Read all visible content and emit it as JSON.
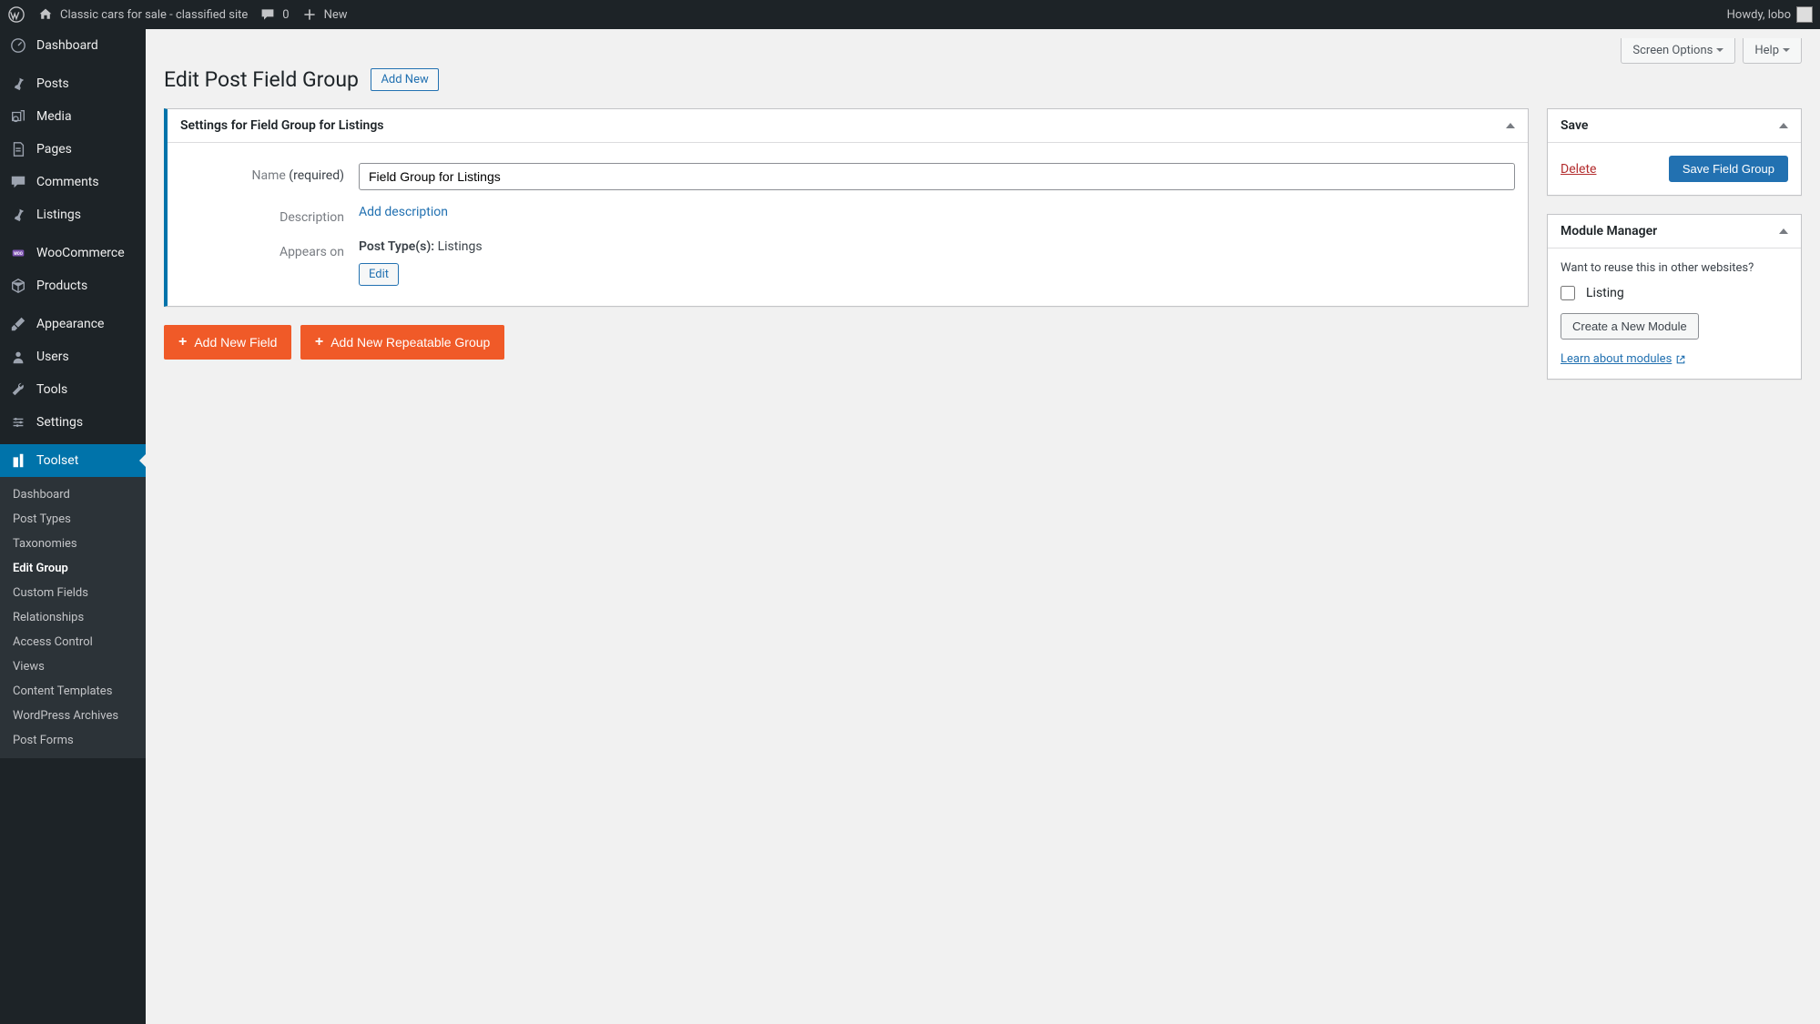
{
  "adminbar": {
    "site_title": "Classic cars for sale - classified site",
    "comments_count": "0",
    "new_label": "New",
    "howdy": "Howdy, lobo"
  },
  "sidebar": {
    "items": [
      {
        "label": "Dashboard",
        "icon": "dashboard"
      },
      {
        "label": "Posts",
        "icon": "pin"
      },
      {
        "label": "Media",
        "icon": "media"
      },
      {
        "label": "Pages",
        "icon": "pages"
      },
      {
        "label": "Comments",
        "icon": "comment"
      },
      {
        "label": "Listings",
        "icon": "pin"
      },
      {
        "label": "WooCommerce",
        "icon": "woo"
      },
      {
        "label": "Products",
        "icon": "products"
      },
      {
        "label": "Appearance",
        "icon": "brush"
      },
      {
        "label": "Users",
        "icon": "user"
      },
      {
        "label": "Tools",
        "icon": "wrench"
      },
      {
        "label": "Settings",
        "icon": "settings"
      },
      {
        "label": "Toolset",
        "icon": "toolset",
        "active": true
      }
    ],
    "submenu": [
      {
        "label": "Dashboard"
      },
      {
        "label": "Post Types"
      },
      {
        "label": "Taxonomies"
      },
      {
        "label": "Edit Group",
        "current": true
      },
      {
        "label": "Custom Fields"
      },
      {
        "label": "Relationships"
      },
      {
        "label": "Access Control"
      },
      {
        "label": "Views"
      },
      {
        "label": "Content Templates"
      },
      {
        "label": "WordPress Archives"
      },
      {
        "label": "Post Forms"
      }
    ]
  },
  "top_tabs": {
    "screen_options": "Screen Options",
    "help": "Help"
  },
  "page": {
    "title": "Edit Post Field Group",
    "add_new": "Add New"
  },
  "settings_box": {
    "heading": "Settings for Field Group for Listings",
    "name_label": "Name",
    "required": "(required)",
    "name_value": "Field Group for Listings",
    "description_label": "Description",
    "add_description": "Add description",
    "appears_label": "Appears on",
    "post_types_label": "Post Type(s):",
    "post_types_value": "Listings",
    "edit": "Edit"
  },
  "buttons": {
    "add_new_field": "Add New Field",
    "add_new_repeatable": "Add New Repeatable Group"
  },
  "save_box": {
    "heading": "Save",
    "delete": "Delete",
    "save": "Save Field Group"
  },
  "module_box": {
    "heading": "Module Manager",
    "question": "Want to reuse this in other websites?",
    "listing": "Listing",
    "create": "Create a New Module",
    "learn": "Learn about modules"
  }
}
